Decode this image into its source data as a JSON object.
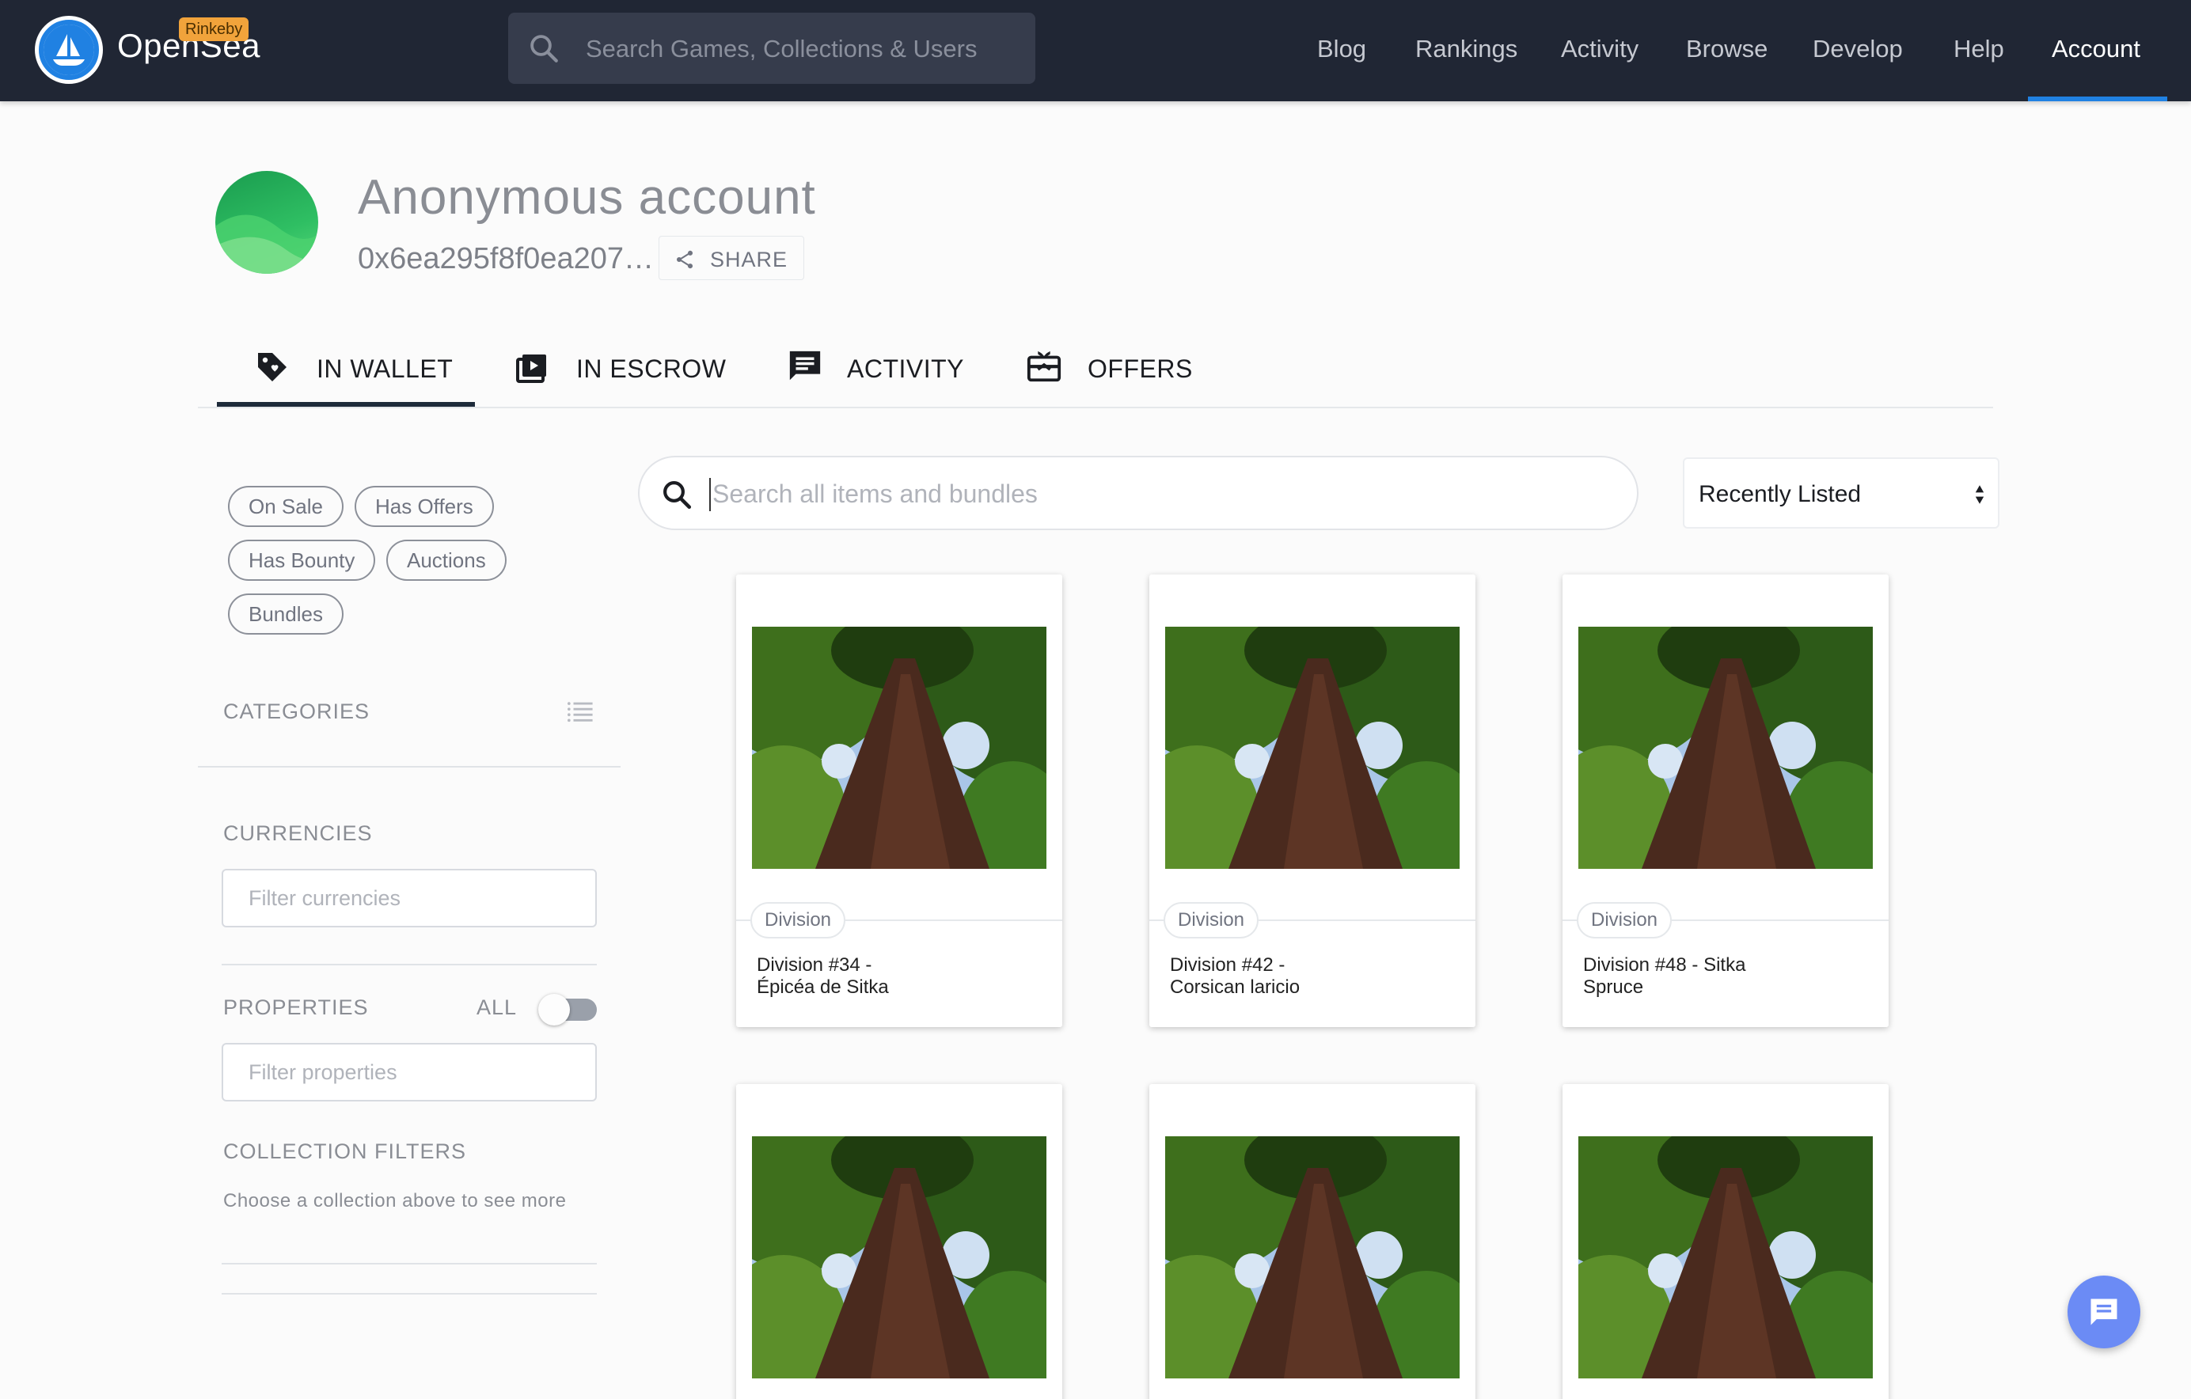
{
  "navbar": {
    "brand": "OpenSea",
    "network_badge": "Rinkeby",
    "search_placeholder": "Search Games, Collections & Users",
    "links": [
      "Blog",
      "Rankings",
      "Activity",
      "Browse",
      "Develop",
      "Help",
      "Account"
    ],
    "active_link": "Account"
  },
  "profile": {
    "name": "Anonymous account",
    "address": "0x6ea295f8f0ea207…",
    "share_label": "SHARE"
  },
  "tabs": [
    {
      "label": "IN WALLET",
      "icon": "tag-icon",
      "active": true
    },
    {
      "label": "IN ESCROW",
      "icon": "escrow-icon",
      "active": false
    },
    {
      "label": "ACTIVITY",
      "icon": "chat-bubble-icon",
      "active": false
    },
    {
      "label": "OFFERS",
      "icon": "gift-card-icon",
      "active": false
    }
  ],
  "sidebar": {
    "status_filters": [
      "On Sale",
      "Has Offers",
      "Has Bounty",
      "Auctions",
      "Bundles"
    ],
    "categories_title": "CATEGORIES",
    "currencies_title": "CURRENCIES",
    "currencies_placeholder": "Filter currencies",
    "properties_title": "PROPERTIES",
    "properties_toggle_label": "ALL",
    "properties_toggle_on": false,
    "properties_placeholder": "Filter properties",
    "collection_filters_title": "COLLECTION FILTERS",
    "collection_filters_helper": "Choose a collection above to see more"
  },
  "main": {
    "search_placeholder": "Search all items and bundles",
    "sort_value": "Recently Listed",
    "cards": [
      {
        "collection": "Division",
        "title": "Division #34 - Épicéa de Sitka"
      },
      {
        "collection": "Division",
        "title": "Division #42 - Corsican laricio"
      },
      {
        "collection": "Division",
        "title": "Division #48 - Sitka Spruce"
      },
      {
        "collection": "",
        "title": ""
      },
      {
        "collection": "",
        "title": ""
      },
      {
        "collection": "",
        "title": ""
      }
    ]
  },
  "colors": {
    "navbar_bg": "#202634",
    "accent": "#2081e2",
    "badge": "#f1a33b",
    "chat_button": "#6b8bf5"
  }
}
